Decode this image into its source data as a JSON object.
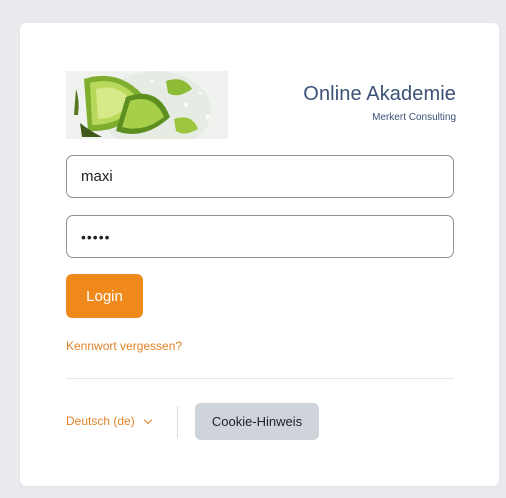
{
  "logo": {
    "title": "Online Akademie",
    "subtitle": "Merkert Consulting",
    "image": "lime-slices-image"
  },
  "form": {
    "username_value": "maxi",
    "password_value": "•••••",
    "login_label": "Login",
    "forgot_label": "Kennwort vergessen?"
  },
  "footer": {
    "language_label": "Deutsch (de)",
    "cookie_label": "Cookie-Hinweis"
  },
  "colors": {
    "accent": "#f0891b",
    "link": "#e08326",
    "brand_text": "#3b5176",
    "background": "#e9ebee"
  }
}
